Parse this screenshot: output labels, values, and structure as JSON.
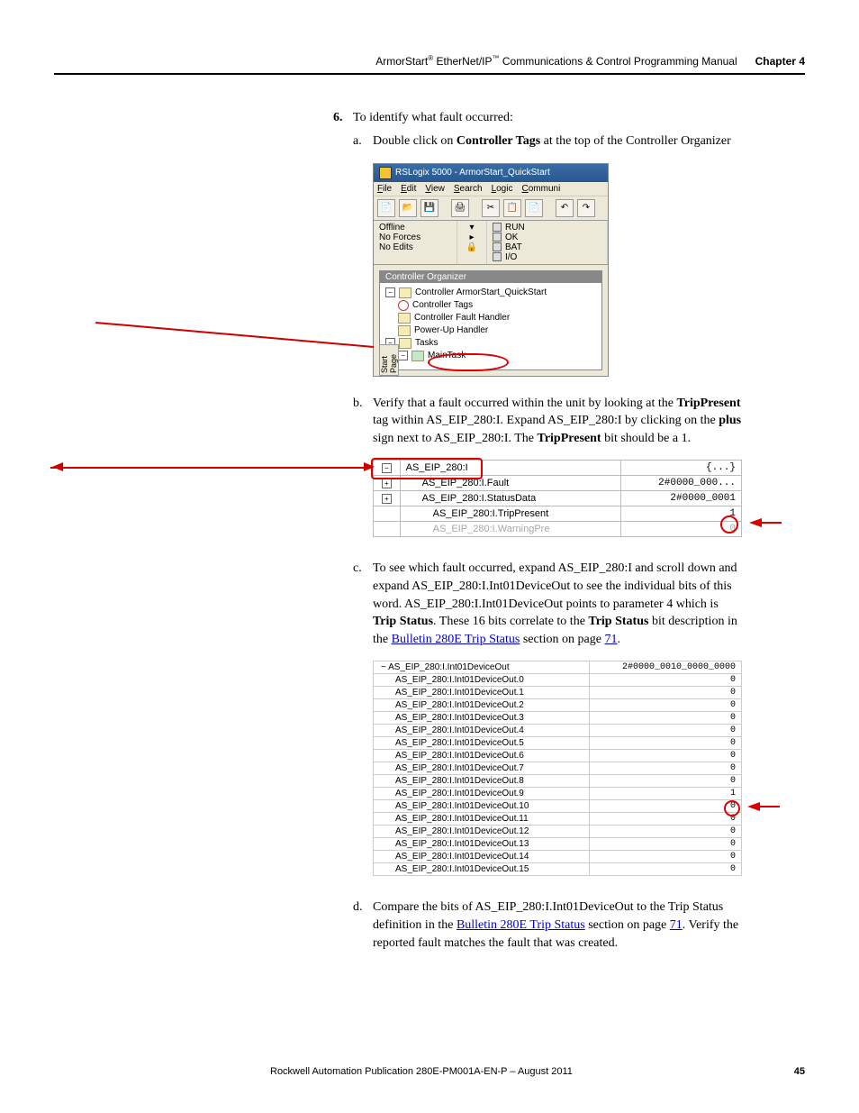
{
  "header": {
    "title_pre": "ArmorStart",
    "title_sup1": "®",
    "title_mid": " EtherNet/IP",
    "title_sup2": "™",
    "title_post": " Communications & Control Programming Manual",
    "chapter": "Chapter 4"
  },
  "step": {
    "number": "6.",
    "text": "To identify what fault occurred:"
  },
  "sub_a": {
    "letter": "a.",
    "pre": "Double click on ",
    "bold": "Controller Tags",
    "post": " at the top of the Controller Organizer"
  },
  "rslogix": {
    "title": "RSLogix 5000 - ArmorStart_QuickStart",
    "menu": [
      "File",
      "Edit",
      "View",
      "Search",
      "Logic",
      "Communi"
    ],
    "status_left": [
      "Offline",
      "No Forces",
      "No Edits"
    ],
    "status_right": [
      "RUN",
      "OK",
      "BAT",
      "I/O"
    ],
    "organizer_title": "Controller Organizer",
    "side_tab": "Start Page",
    "tree": {
      "root": "Controller ArmorStart_QuickStart",
      "items": [
        "Controller Tags",
        "Controller Fault Handler",
        "Power-Up Handler"
      ],
      "tasks": "Tasks",
      "main": "MainTask"
    }
  },
  "sub_b": {
    "letter": "b.",
    "t1": "Verify that a fault occurred within the unit by looking at the ",
    "bold1": "TripPresent",
    "t2": " tag within AS_EIP_280:I. Expand AS_EIP_280:I by clicking on the ",
    "bold2": "plus",
    "t3": " sign next to AS_EIP_280:I. The ",
    "bold3": "TripPresent",
    "t4": " bit should be a 1."
  },
  "table_b": {
    "rows": [
      {
        "box": "−",
        "name": "AS_EIP_280:I",
        "val": "{...}"
      },
      {
        "box": "+",
        "indent": "s",
        "name": "AS_EIP_280:I.Fault",
        "val": "2#0000_000..."
      },
      {
        "box": "+",
        "indent": "s",
        "name": "AS_EIP_280:I.StatusData",
        "val": "2#0000_0001"
      },
      {
        "box": "",
        "indent": "m",
        "name": "AS_EIP_280:I.TripPresent",
        "val": "1"
      },
      {
        "box": "",
        "indent": "m",
        "name": "AS_EIP_280:I.WarningPre",
        "val": "0",
        "faded": true
      }
    ]
  },
  "sub_c": {
    "letter": "c.",
    "t1": "To see which fault occurred, expand AS_EIP_280:I and scroll down and expand AS_EIP_280:I.Int01DeviceOut to see the individual bits of this word. AS_EIP_280:I.Int01DeviceOut points to parameter 4 which is ",
    "bold1": "Trip Status",
    "t2": ". These 16 bits correlate to the ",
    "bold2": "Trip Status",
    "t3": " bit description in the ",
    "link": "Bulletin 280E Trip Status",
    "t4": " section on page ",
    "pagelink": "71",
    "t5": "."
  },
  "table_c": {
    "head_name": "AS_EIP_280:I.Int01DeviceOut",
    "head_val": "2#0000_0010_0000_0000",
    "rows": [
      {
        "name": "AS_EIP_280:I.Int01DeviceOut.0",
        "val": "0"
      },
      {
        "name": "AS_EIP_280:I.Int01DeviceOut.1",
        "val": "0"
      },
      {
        "name": "AS_EIP_280:I.Int01DeviceOut.2",
        "val": "0"
      },
      {
        "name": "AS_EIP_280:I.Int01DeviceOut.3",
        "val": "0"
      },
      {
        "name": "AS_EIP_280:I.Int01DeviceOut.4",
        "val": "0"
      },
      {
        "name": "AS_EIP_280:I.Int01DeviceOut.5",
        "val": "0"
      },
      {
        "name": "AS_EIP_280:I.Int01DeviceOut.6",
        "val": "0"
      },
      {
        "name": "AS_EIP_280:I.Int01DeviceOut.7",
        "val": "0"
      },
      {
        "name": "AS_EIP_280:I.Int01DeviceOut.8",
        "val": "0"
      },
      {
        "name": "AS_EIP_280:I.Int01DeviceOut.9",
        "val": "1"
      },
      {
        "name": "AS_EIP_280:I.Int01DeviceOut.10",
        "val": "0"
      },
      {
        "name": "AS_EIP_280:I.Int01DeviceOut.11",
        "val": "0"
      },
      {
        "name": "AS_EIP_280:I.Int01DeviceOut.12",
        "val": "0"
      },
      {
        "name": "AS_EIP_280:I.Int01DeviceOut.13",
        "val": "0"
      },
      {
        "name": "AS_EIP_280:I.Int01DeviceOut.14",
        "val": "0"
      },
      {
        "name": "AS_EIP_280:I.Int01DeviceOut.15",
        "val": "0"
      }
    ]
  },
  "sub_d": {
    "letter": "d.",
    "t1": "Compare the bits of AS_EIP_280:I.Int01DeviceOut to the Trip Status definition in the ",
    "link": "Bulletin 280E Trip Status",
    "t2": " section on page ",
    "pagelink": "71",
    "t3": ". Verify the reported fault matches the fault that was created."
  },
  "footer": {
    "pub": "Rockwell Automation Publication 280E-PM001A-EN-P – August 2011",
    "page": "45"
  }
}
